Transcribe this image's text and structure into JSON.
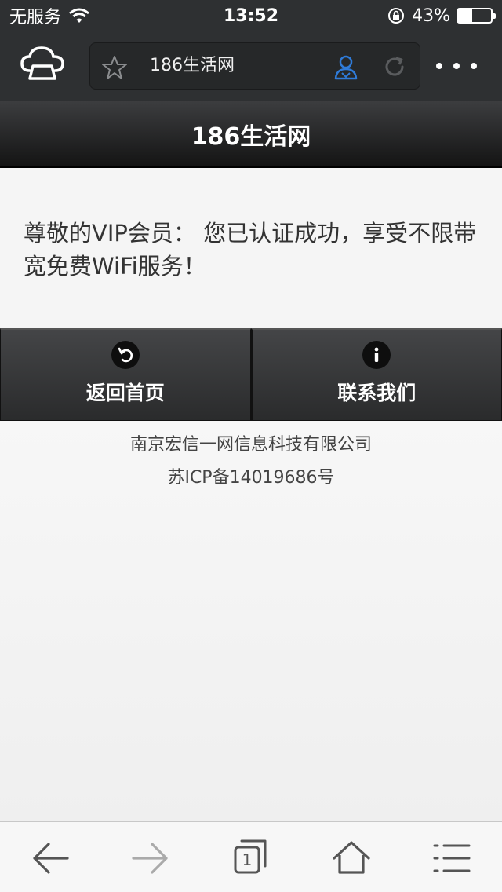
{
  "status_bar": {
    "carrier": "无服务",
    "time": "13:52",
    "battery_percent": "43%",
    "battery_level": 0.43,
    "icons": [
      "wifi-icon",
      "orientation-lock-icon",
      "battery-icon"
    ]
  },
  "browser": {
    "url_title": "186生活网",
    "icons": [
      "cloud-icon",
      "star-icon",
      "vip-user-icon",
      "reload-icon",
      "more-icon"
    ]
  },
  "page": {
    "header_title": "186生活网",
    "message": "尊敬的VIP会员： 您已认证成功，享受不限带宽免费WiFi服务！",
    "buttons": [
      {
        "label": "返回首页",
        "icon": "return-icon"
      },
      {
        "label": "联系我们",
        "icon": "info-icon"
      }
    ],
    "footer": {
      "company": "南京宏信一网信息科技有限公司",
      "icp": "苏ICP备14019686号"
    }
  },
  "toolbar": {
    "tab_count": "1",
    "icons": [
      "back-icon",
      "forward-icon",
      "tabs-icon",
      "home-icon",
      "menu-icon"
    ]
  },
  "colors": {
    "bar_background": "#2e3032",
    "accent_blue": "#2f7bd8",
    "page_background": "#f0f0f0"
  }
}
